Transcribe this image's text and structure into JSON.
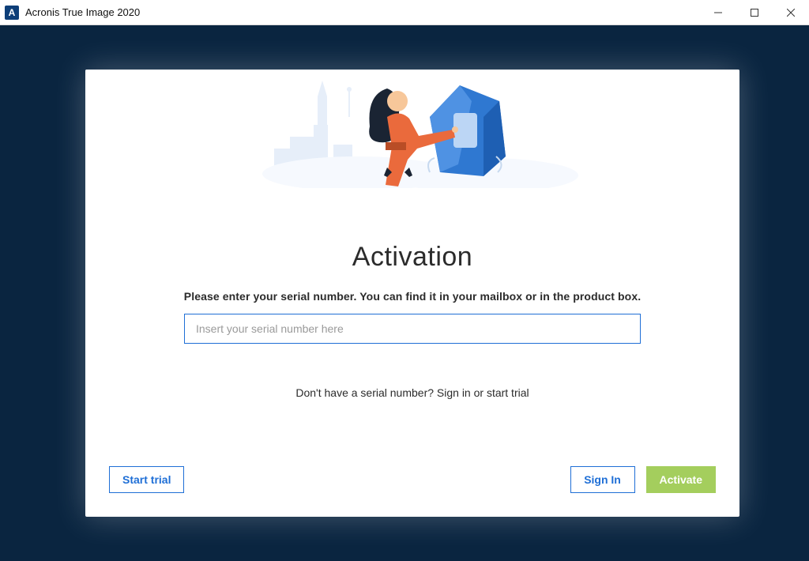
{
  "window": {
    "title": "Acronis True Image 2020",
    "appicon_letter": "A"
  },
  "activation": {
    "heading": "Activation",
    "instruction": "Please enter your serial number. You can find it in your mailbox or in the product box.",
    "serial_placeholder": "Insert your serial number here",
    "serial_value": "",
    "helper_text": "Don't have a serial number? Sign in or start trial"
  },
  "buttons": {
    "start_trial": "Start trial",
    "sign_in": "Sign In",
    "activate": "Activate"
  },
  "colors": {
    "frame": "#0a2540",
    "accent": "#1f6fd6",
    "activate": "#a4ce5d"
  }
}
